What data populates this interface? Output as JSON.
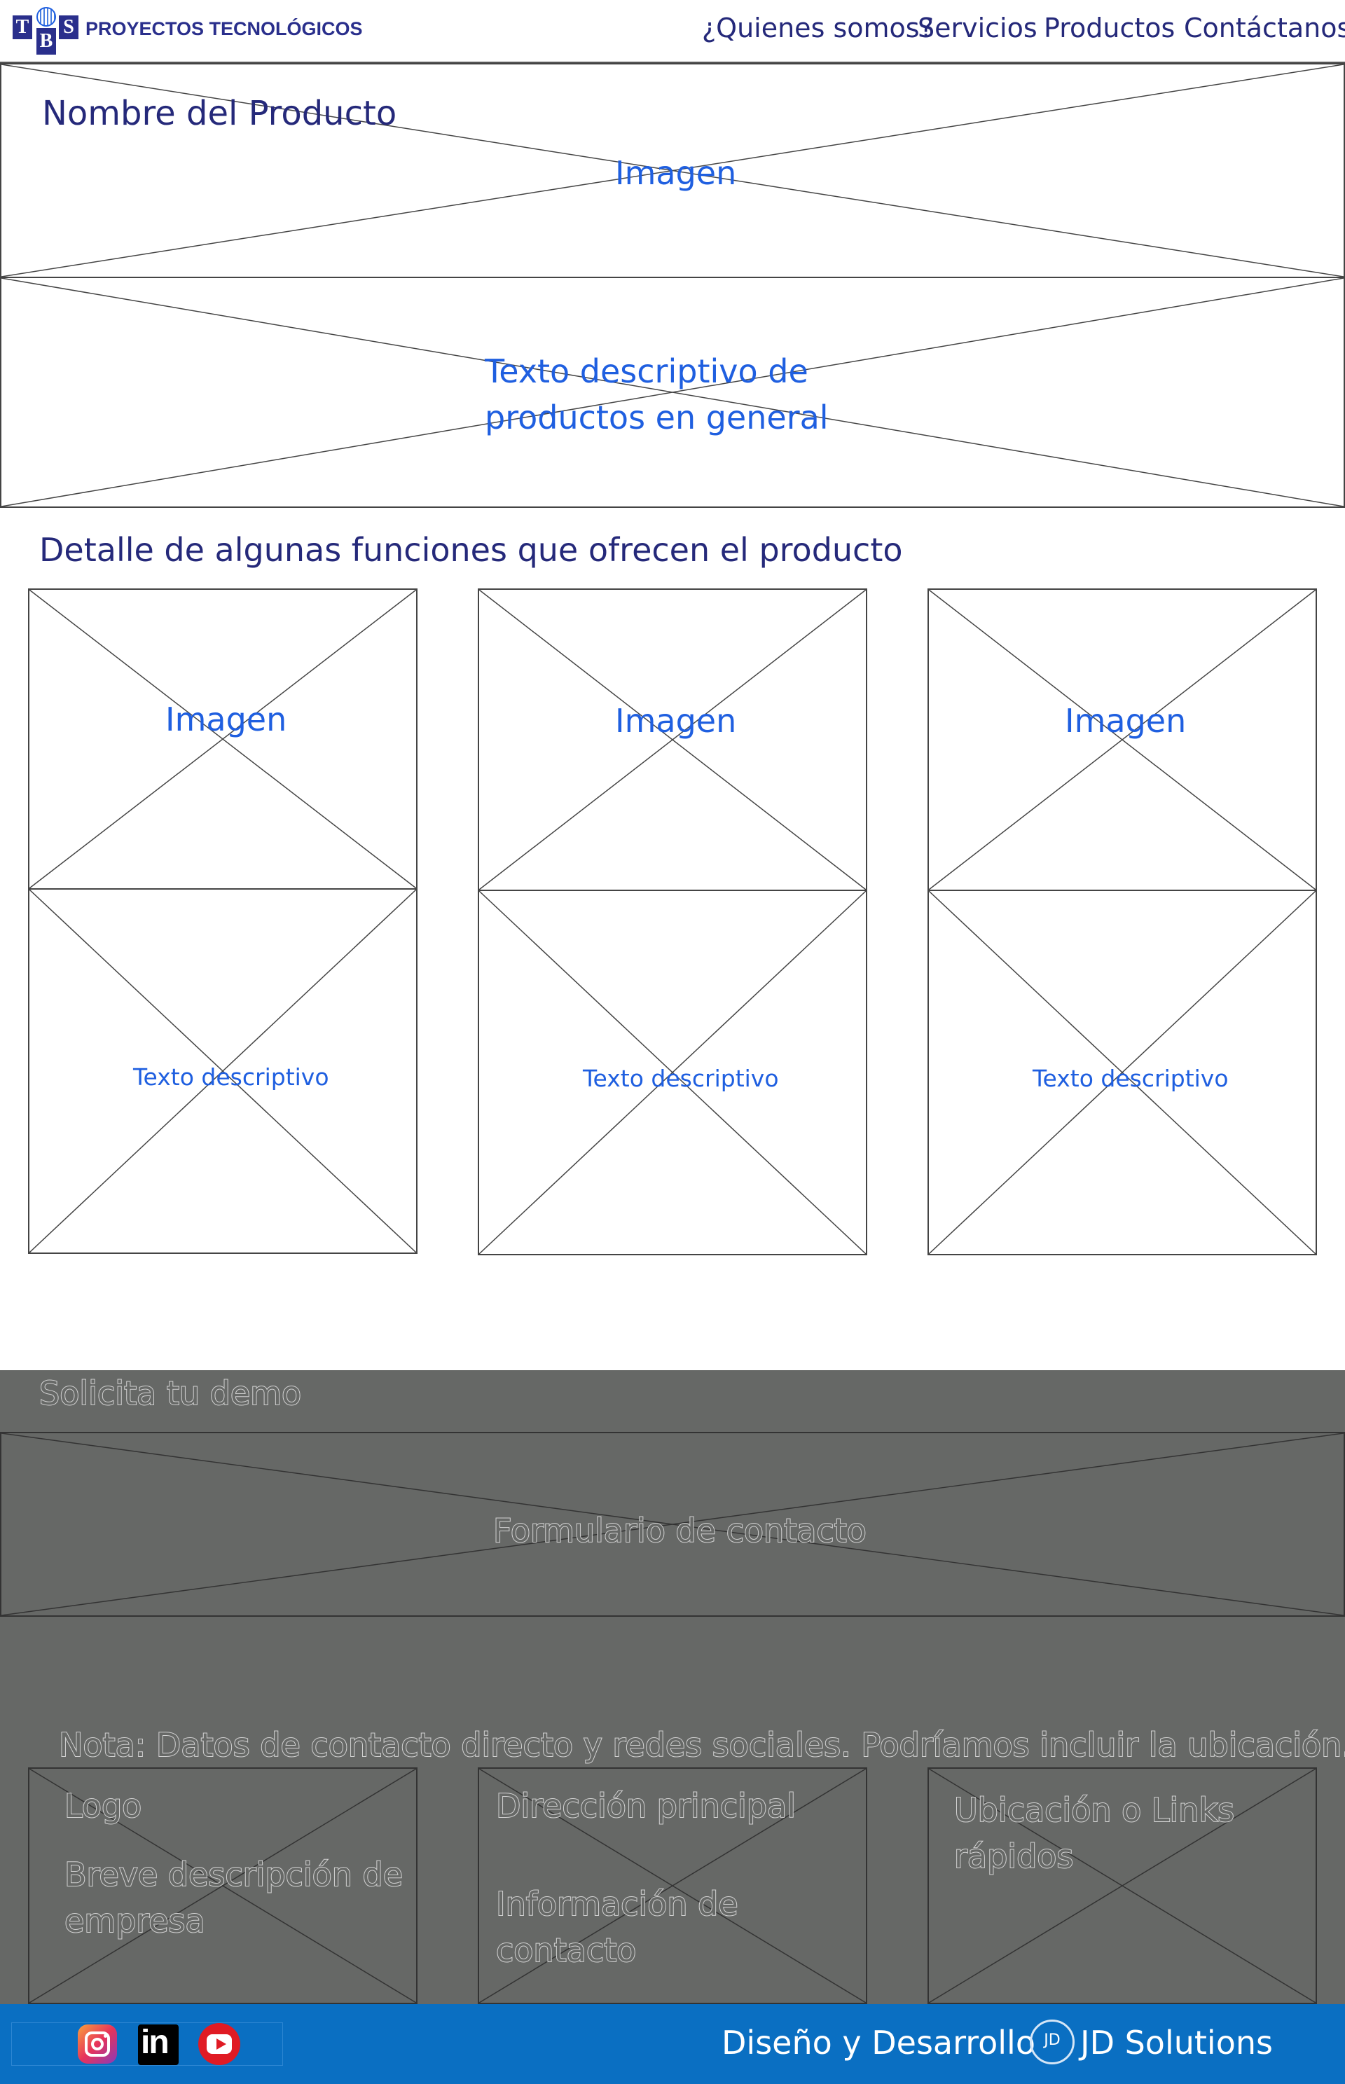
{
  "header": {
    "logo_letters": [
      "T",
      "B",
      "S"
    ],
    "logo_text": "PROYECTOS TECNOLÓGICOS",
    "nav": [
      "¿Quienes somos?",
      "Servicios",
      "Productos",
      "Contáctanos"
    ]
  },
  "hero": {
    "product_name": "Nombre del Producto",
    "image_label": "Imagen"
  },
  "description": {
    "text_line1": "Texto descriptivo de",
    "text_line2": "productos en general"
  },
  "features": {
    "title": "Detalle de algunas funciones que ofrecen el producto",
    "cards": [
      {
        "image_label": "Imagen",
        "text_label": "Texto descriptivo"
      },
      {
        "image_label": "Imagen",
        "text_label": "Texto descriptivo"
      },
      {
        "image_label": "Imagen",
        "text_label": "Texto descriptivo"
      }
    ]
  },
  "demo": {
    "title": "Solicita tu demo",
    "form_label": "Formulario de contacto"
  },
  "footer_info": {
    "note": "Nota: Datos de contacto directo y redes sociales. Podríamos incluir la ubicación.",
    "col1_title": "Logo",
    "col1_line1": "Breve descripción de",
    "col1_line2": "empresa",
    "col2_title": "Dirección principal",
    "col2_line1": "Información de",
    "col2_line2": "contacto",
    "col3_line1": "Ubicación o Links",
    "col3_line2": "rápidos"
  },
  "bottom_bar": {
    "social_icons": [
      "instagram-icon",
      "linkedin-icon",
      "youtube-icon"
    ],
    "linkedin_text": "in",
    "credit_text": "Diseño y Desarrollo",
    "brand_badge": "JD",
    "brand_name": "JD Solutions"
  },
  "colors": {
    "navy": "#25297a",
    "label_blue": "#1f5fe0",
    "dark_section": "#666866",
    "bottom_bar": "#0a6fc2"
  }
}
